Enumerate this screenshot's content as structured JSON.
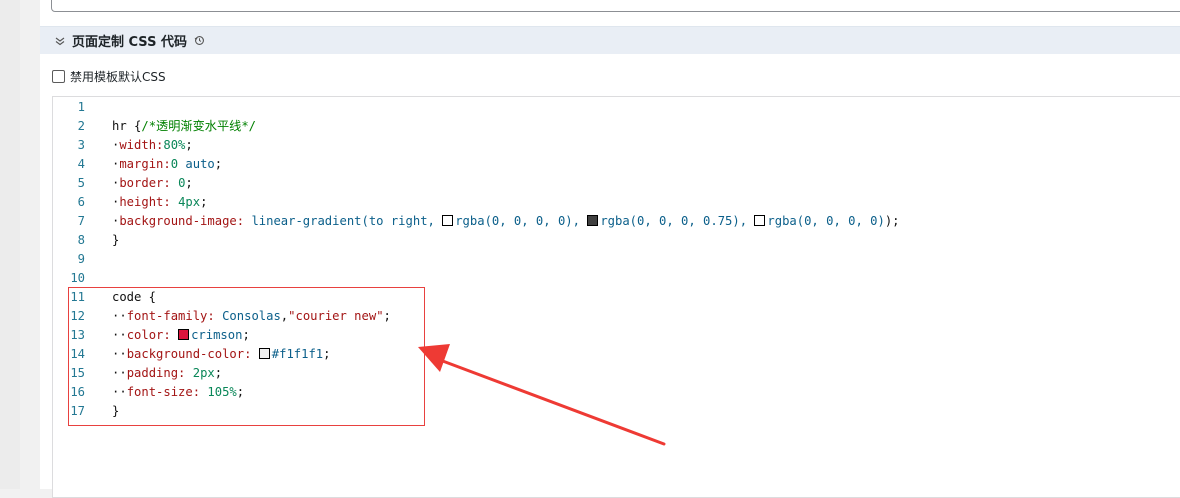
{
  "section": {
    "title": "页面定制 CSS 代码",
    "collapse_icon": "chevron-down-icon",
    "reset_icon": "history-reset-icon"
  },
  "option": {
    "disable_default_css_label": "禁用模板默认CSS",
    "checked": false
  },
  "editor": {
    "lines": [
      {
        "num": "1",
        "tokens": []
      },
      {
        "num": "2",
        "tokens": [
          {
            "t": "plain",
            "v": "hr {"
          },
          {
            "t": "cmt",
            "v": "/*透明渐变水平线*/"
          }
        ]
      },
      {
        "num": "3",
        "tokens": [
          {
            "t": "guide",
            "v": "·"
          },
          {
            "t": "prop",
            "v": "width:"
          },
          {
            "t": "num",
            "v": "80%"
          },
          {
            "t": "plain",
            "v": ";"
          }
        ]
      },
      {
        "num": "4",
        "tokens": [
          {
            "t": "guide",
            "v": "·"
          },
          {
            "t": "prop",
            "v": "margin:"
          },
          {
            "t": "num",
            "v": "0"
          },
          {
            "t": "plain",
            "v": " "
          },
          {
            "t": "val",
            "v": "auto"
          },
          {
            "t": "plain",
            "v": ";"
          }
        ]
      },
      {
        "num": "5",
        "tokens": [
          {
            "t": "guide",
            "v": "·"
          },
          {
            "t": "prop",
            "v": "border:"
          },
          {
            "t": "plain",
            "v": " "
          },
          {
            "t": "num",
            "v": "0"
          },
          {
            "t": "plain",
            "v": ";"
          }
        ]
      },
      {
        "num": "6",
        "tokens": [
          {
            "t": "guide",
            "v": "·"
          },
          {
            "t": "prop",
            "v": "height:"
          },
          {
            "t": "plain",
            "v": " "
          },
          {
            "t": "num",
            "v": "4px"
          },
          {
            "t": "plain",
            "v": ";"
          }
        ]
      },
      {
        "num": "7",
        "tokens": [
          {
            "t": "guide",
            "v": "·"
          },
          {
            "t": "prop",
            "v": "background-image:"
          },
          {
            "t": "plain",
            "v": " "
          },
          {
            "t": "val",
            "v": "linear-gradient(to right,"
          },
          {
            "t": "plain",
            "v": " "
          },
          {
            "t": "swatch",
            "v": "#ffffff"
          },
          {
            "t": "val",
            "v": "rgba(0, 0, 0, 0),"
          },
          {
            "t": "plain",
            "v": " "
          },
          {
            "t": "swatch",
            "v": "#404040"
          },
          {
            "t": "val",
            "v": "rgba(0, 0, 0, 0.75),"
          },
          {
            "t": "plain",
            "v": " "
          },
          {
            "t": "swatch",
            "v": "#ffffff"
          },
          {
            "t": "val",
            "v": "rgba(0, 0, 0, 0)"
          },
          {
            "t": "plain",
            "v": ");"
          }
        ]
      },
      {
        "num": "8",
        "tokens": [
          {
            "t": "plain",
            "v": "}"
          }
        ]
      },
      {
        "num": "9",
        "tokens": []
      },
      {
        "num": "10",
        "tokens": []
      },
      {
        "num": "11",
        "tokens": [
          {
            "t": "plain",
            "v": "code {"
          }
        ]
      },
      {
        "num": "12",
        "tokens": [
          {
            "t": "guide",
            "v": "··"
          },
          {
            "t": "prop",
            "v": "font-family:"
          },
          {
            "t": "plain",
            "v": " "
          },
          {
            "t": "val",
            "v": "Consolas"
          },
          {
            "t": "plain",
            "v": ","
          },
          {
            "t": "str",
            "v": "\"courier new\""
          },
          {
            "t": "plain",
            "v": ";"
          }
        ]
      },
      {
        "num": "13",
        "tokens": [
          {
            "t": "guide",
            "v": "··"
          },
          {
            "t": "prop",
            "v": "color:"
          },
          {
            "t": "plain",
            "v": " "
          },
          {
            "t": "swatch",
            "v": "#dc143c"
          },
          {
            "t": "val",
            "v": "crimson"
          },
          {
            "t": "plain",
            "v": ";"
          }
        ]
      },
      {
        "num": "14",
        "tokens": [
          {
            "t": "guide",
            "v": "··"
          },
          {
            "t": "prop",
            "v": "background-color:"
          },
          {
            "t": "plain",
            "v": " "
          },
          {
            "t": "swatch",
            "v": "#f1f1f1"
          },
          {
            "t": "val",
            "v": "#f1f1f1"
          },
          {
            "t": "plain",
            "v": ";"
          }
        ]
      },
      {
        "num": "15",
        "tokens": [
          {
            "t": "guide",
            "v": "··"
          },
          {
            "t": "prop",
            "v": "padding:"
          },
          {
            "t": "plain",
            "v": " "
          },
          {
            "t": "num",
            "v": "2px"
          },
          {
            "t": "plain",
            "v": ";"
          }
        ]
      },
      {
        "num": "16",
        "tokens": [
          {
            "t": "guide",
            "v": "··"
          },
          {
            "t": "prop",
            "v": "font-size:"
          },
          {
            "t": "plain",
            "v": " "
          },
          {
            "t": "num",
            "v": "105%"
          },
          {
            "t": "plain",
            "v": ";"
          }
        ]
      },
      {
        "num": "17",
        "tokens": [
          {
            "t": "plain",
            "v": "}"
          }
        ]
      }
    ]
  },
  "annotation": {
    "box_color": "#e8413f",
    "arrow_color": "#ee3a34"
  }
}
